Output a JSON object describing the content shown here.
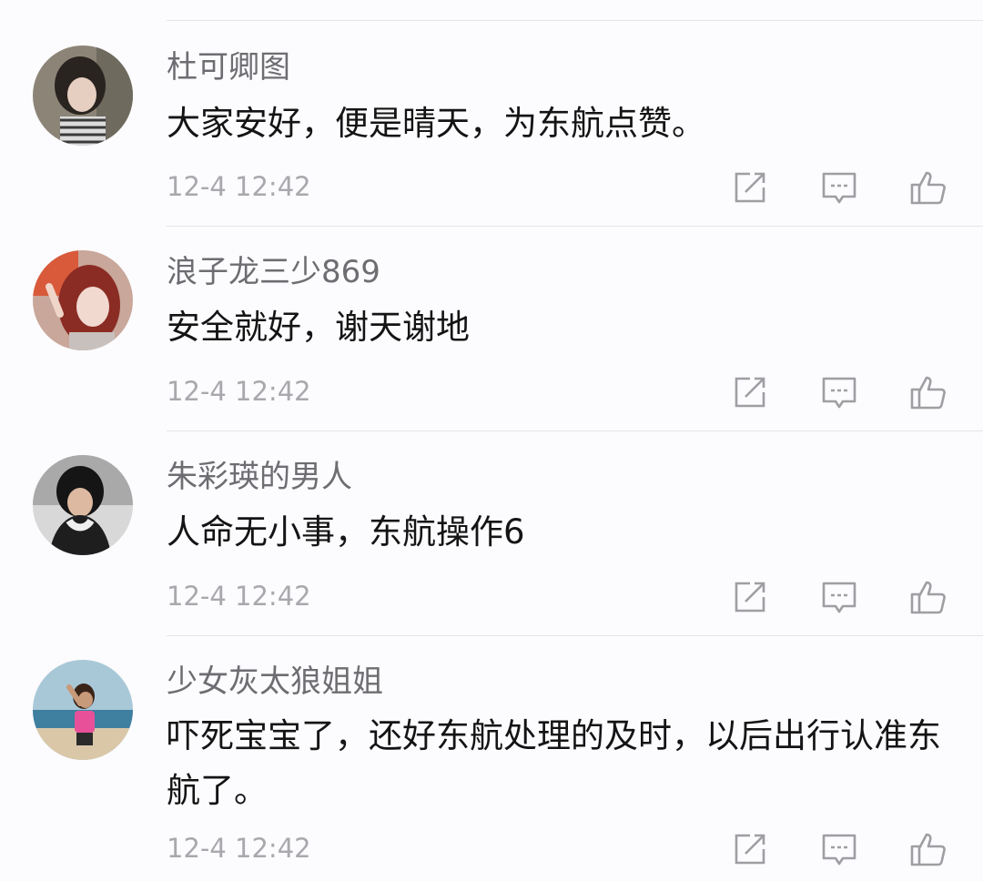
{
  "comments": [
    {
      "username": "杜可卿图",
      "content": "大家安好，便是晴天，为东航点赞。",
      "time": "12-4 12:42",
      "avatar_icon": "user-photo-avatar"
    },
    {
      "username": "浪子龙三少869",
      "content": "安全就好，谢天谢地",
      "time": "12-4 12:42",
      "avatar_icon": "user-photo-avatar"
    },
    {
      "username": "朱彩瑛的男人",
      "content": "人命无小事，东航操作6",
      "time": "12-4 12:42",
      "avatar_icon": "user-photo-avatar"
    },
    {
      "username": "少女灰太狼姐姐",
      "content": "吓死宝宝了，还好东航处理的及时，以后出行认准东航了。",
      "time": "12-4 12:42",
      "avatar_icon": "user-photo-avatar"
    }
  ],
  "icons": {
    "share": "share-icon",
    "reply": "comment-reply-icon",
    "like": "thumbs-up-icon"
  },
  "colors": {
    "background": "#fcfbfd",
    "username": "#6d6d72",
    "content": "#141414",
    "time": "#a8a8ad",
    "icon": "#9e9ea3",
    "divider": "#e6e4e9"
  }
}
